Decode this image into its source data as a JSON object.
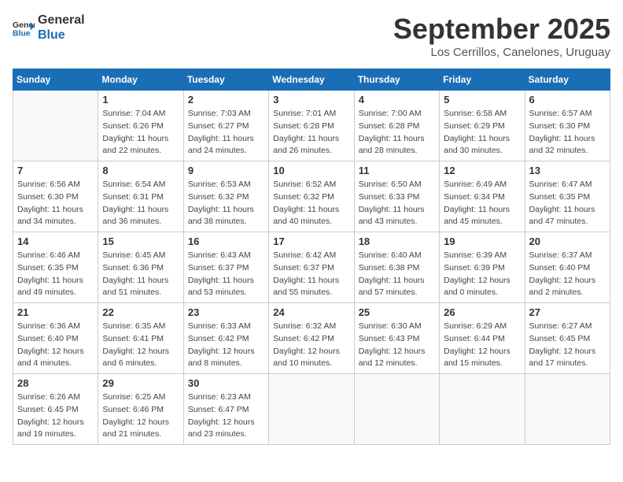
{
  "header": {
    "logo_line1": "General",
    "logo_line2": "Blue",
    "month": "September 2025",
    "location": "Los Cerrillos, Canelones, Uruguay"
  },
  "weekdays": [
    "Sunday",
    "Monday",
    "Tuesday",
    "Wednesday",
    "Thursday",
    "Friday",
    "Saturday"
  ],
  "weeks": [
    [
      {
        "day": "",
        "sunrise": "",
        "sunset": "",
        "daylight": ""
      },
      {
        "day": "1",
        "sunrise": "Sunrise: 7:04 AM",
        "sunset": "Sunset: 6:26 PM",
        "daylight": "Daylight: 11 hours and 22 minutes."
      },
      {
        "day": "2",
        "sunrise": "Sunrise: 7:03 AM",
        "sunset": "Sunset: 6:27 PM",
        "daylight": "Daylight: 11 hours and 24 minutes."
      },
      {
        "day": "3",
        "sunrise": "Sunrise: 7:01 AM",
        "sunset": "Sunset: 6:28 PM",
        "daylight": "Daylight: 11 hours and 26 minutes."
      },
      {
        "day": "4",
        "sunrise": "Sunrise: 7:00 AM",
        "sunset": "Sunset: 6:28 PM",
        "daylight": "Daylight: 11 hours and 28 minutes."
      },
      {
        "day": "5",
        "sunrise": "Sunrise: 6:58 AM",
        "sunset": "Sunset: 6:29 PM",
        "daylight": "Daylight: 11 hours and 30 minutes."
      },
      {
        "day": "6",
        "sunrise": "Sunrise: 6:57 AM",
        "sunset": "Sunset: 6:30 PM",
        "daylight": "Daylight: 11 hours and 32 minutes."
      }
    ],
    [
      {
        "day": "7",
        "sunrise": "Sunrise: 6:56 AM",
        "sunset": "Sunset: 6:30 PM",
        "daylight": "Daylight: 11 hours and 34 minutes."
      },
      {
        "day": "8",
        "sunrise": "Sunrise: 6:54 AM",
        "sunset": "Sunset: 6:31 PM",
        "daylight": "Daylight: 11 hours and 36 minutes."
      },
      {
        "day": "9",
        "sunrise": "Sunrise: 6:53 AM",
        "sunset": "Sunset: 6:32 PM",
        "daylight": "Daylight: 11 hours and 38 minutes."
      },
      {
        "day": "10",
        "sunrise": "Sunrise: 6:52 AM",
        "sunset": "Sunset: 6:32 PM",
        "daylight": "Daylight: 11 hours and 40 minutes."
      },
      {
        "day": "11",
        "sunrise": "Sunrise: 6:50 AM",
        "sunset": "Sunset: 6:33 PM",
        "daylight": "Daylight: 11 hours and 43 minutes."
      },
      {
        "day": "12",
        "sunrise": "Sunrise: 6:49 AM",
        "sunset": "Sunset: 6:34 PM",
        "daylight": "Daylight: 11 hours and 45 minutes."
      },
      {
        "day": "13",
        "sunrise": "Sunrise: 6:47 AM",
        "sunset": "Sunset: 6:35 PM",
        "daylight": "Daylight: 11 hours and 47 minutes."
      }
    ],
    [
      {
        "day": "14",
        "sunrise": "Sunrise: 6:46 AM",
        "sunset": "Sunset: 6:35 PM",
        "daylight": "Daylight: 11 hours and 49 minutes."
      },
      {
        "day": "15",
        "sunrise": "Sunrise: 6:45 AM",
        "sunset": "Sunset: 6:36 PM",
        "daylight": "Daylight: 11 hours and 51 minutes."
      },
      {
        "day": "16",
        "sunrise": "Sunrise: 6:43 AM",
        "sunset": "Sunset: 6:37 PM",
        "daylight": "Daylight: 11 hours and 53 minutes."
      },
      {
        "day": "17",
        "sunrise": "Sunrise: 6:42 AM",
        "sunset": "Sunset: 6:37 PM",
        "daylight": "Daylight: 11 hours and 55 minutes."
      },
      {
        "day": "18",
        "sunrise": "Sunrise: 6:40 AM",
        "sunset": "Sunset: 6:38 PM",
        "daylight": "Daylight: 11 hours and 57 minutes."
      },
      {
        "day": "19",
        "sunrise": "Sunrise: 6:39 AM",
        "sunset": "Sunset: 6:39 PM",
        "daylight": "Daylight: 12 hours and 0 minutes."
      },
      {
        "day": "20",
        "sunrise": "Sunrise: 6:37 AM",
        "sunset": "Sunset: 6:40 PM",
        "daylight": "Daylight: 12 hours and 2 minutes."
      }
    ],
    [
      {
        "day": "21",
        "sunrise": "Sunrise: 6:36 AM",
        "sunset": "Sunset: 6:40 PM",
        "daylight": "Daylight: 12 hours and 4 minutes."
      },
      {
        "day": "22",
        "sunrise": "Sunrise: 6:35 AM",
        "sunset": "Sunset: 6:41 PM",
        "daylight": "Daylight: 12 hours and 6 minutes."
      },
      {
        "day": "23",
        "sunrise": "Sunrise: 6:33 AM",
        "sunset": "Sunset: 6:42 PM",
        "daylight": "Daylight: 12 hours and 8 minutes."
      },
      {
        "day": "24",
        "sunrise": "Sunrise: 6:32 AM",
        "sunset": "Sunset: 6:42 PM",
        "daylight": "Daylight: 12 hours and 10 minutes."
      },
      {
        "day": "25",
        "sunrise": "Sunrise: 6:30 AM",
        "sunset": "Sunset: 6:43 PM",
        "daylight": "Daylight: 12 hours and 12 minutes."
      },
      {
        "day": "26",
        "sunrise": "Sunrise: 6:29 AM",
        "sunset": "Sunset: 6:44 PM",
        "daylight": "Daylight: 12 hours and 15 minutes."
      },
      {
        "day": "27",
        "sunrise": "Sunrise: 6:27 AM",
        "sunset": "Sunset: 6:45 PM",
        "daylight": "Daylight: 12 hours and 17 minutes."
      }
    ],
    [
      {
        "day": "28",
        "sunrise": "Sunrise: 6:26 AM",
        "sunset": "Sunset: 6:45 PM",
        "daylight": "Daylight: 12 hours and 19 minutes."
      },
      {
        "day": "29",
        "sunrise": "Sunrise: 6:25 AM",
        "sunset": "Sunset: 6:46 PM",
        "daylight": "Daylight: 12 hours and 21 minutes."
      },
      {
        "day": "30",
        "sunrise": "Sunrise: 6:23 AM",
        "sunset": "Sunset: 6:47 PM",
        "daylight": "Daylight: 12 hours and 23 minutes."
      },
      {
        "day": "",
        "sunrise": "",
        "sunset": "",
        "daylight": ""
      },
      {
        "day": "",
        "sunrise": "",
        "sunset": "",
        "daylight": ""
      },
      {
        "day": "",
        "sunrise": "",
        "sunset": "",
        "daylight": ""
      },
      {
        "day": "",
        "sunrise": "",
        "sunset": "",
        "daylight": ""
      }
    ]
  ]
}
